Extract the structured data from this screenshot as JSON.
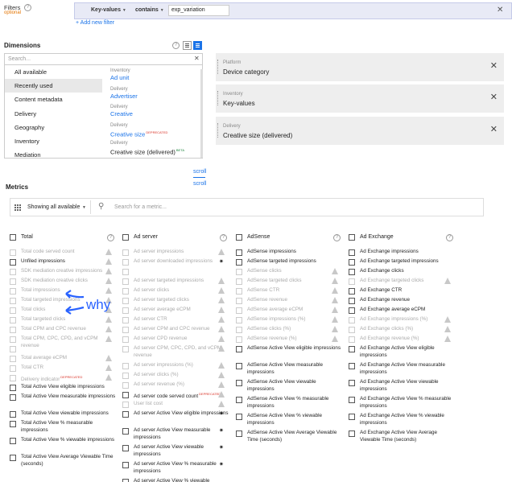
{
  "filters": {
    "label": "Filters",
    "optional": "optional",
    "key": "Key-values",
    "operator": "contains",
    "value": "exp_variation",
    "add_filter": "+ Add new filter"
  },
  "dimensions": {
    "title": "Dimensions",
    "search_placeholder": "Search...",
    "categories": [
      "All available",
      "Recently used",
      "Content metadata",
      "Delivery",
      "Geography",
      "Inventory",
      "Mediation"
    ],
    "selected_category": "Recently used",
    "items": [
      {
        "category": "Inventory",
        "name": "Ad unit"
      },
      {
        "category": "Delivery",
        "name": "Advertiser"
      },
      {
        "category": "Delivery",
        "name": "Creative"
      },
      {
        "category": "Delivery",
        "name": "Creative size",
        "tag": "DEPRECATED"
      },
      {
        "category": "Delivery",
        "name": "Creative size (delivered)",
        "tag": "BETA"
      }
    ],
    "scroll_label": "scroll",
    "selected": [
      {
        "category": "Platform",
        "name": "Device category"
      },
      {
        "category": "Inventory",
        "name": "Key-values"
      },
      {
        "category": "Delivery",
        "name": "Creative size (delivered)"
      }
    ]
  },
  "metrics": {
    "title": "Metrics",
    "show_label": "Showing all available",
    "search_placeholder": "Search for a metric...",
    "columns": [
      {
        "title": "Total",
        "rows": [
          {
            "label": "Total code served count",
            "disabled": true,
            "warn": true
          },
          {
            "label": "Unfiled impressions",
            "disabled": false,
            "warn": true
          },
          {
            "label": "SDK mediation creative impressions",
            "disabled": true,
            "warn": true
          },
          {
            "label": "SDK mediation creative clicks",
            "disabled": true,
            "warn": true
          },
          {
            "label": "Total impressions",
            "disabled": true,
            "warn": true
          },
          {
            "label": "Total targeted impressions",
            "disabled": true,
            "warn": true
          },
          {
            "label": "Total clicks",
            "disabled": true,
            "warn": true
          },
          {
            "label": "Total targeted clicks",
            "disabled": true,
            "warn": true
          },
          {
            "label": "Total CPM and CPC revenue",
            "disabled": true,
            "warn": true
          },
          {
            "label": "Total CPM, CPC, CPD, and vCPM revenue",
            "disabled": true,
            "warn": true
          },
          {
            "label": "",
            "disabled": true,
            "warn": false
          },
          {
            "label": "Total average eCPM",
            "disabled": true,
            "warn": true
          },
          {
            "label": "Total CTR",
            "disabled": true,
            "warn": true
          },
          {
            "label": "Delivery indicator",
            "tag": "DEPRECATED",
            "disabled": true,
            "warn": true
          },
          {
            "label": "Total Active View eligible impressions",
            "disabled": false
          },
          {
            "label": "Total Active View measurable impressions",
            "disabled": false,
            "lines": 2
          },
          {
            "label": "Total Active View viewable impressions",
            "disabled": false
          },
          {
            "label": "Total Active View % measurable impressions",
            "disabled": false,
            "lines": 2
          },
          {
            "label": "Total Active View % viewable impressions",
            "disabled": false,
            "lines": 2
          },
          {
            "label": "Total Active View Average Viewable Time (seconds)",
            "disabled": false,
            "lines": 2
          }
        ]
      },
      {
        "title": "Ad server",
        "rows": [
          {
            "label": "Ad server impressions",
            "disabled": true,
            "warn": true
          },
          {
            "label": "Ad server downloaded impressions",
            "disabled": true,
            "bug": true
          },
          {
            "label": "",
            "disabled": true
          },
          {
            "label": "Ad server targeted impressions",
            "disabled": true,
            "warn": true
          },
          {
            "label": "Ad server clicks",
            "disabled": true,
            "warn": true
          },
          {
            "label": "Ad server targeted clicks",
            "disabled": true,
            "warn": true
          },
          {
            "label": "Ad server average eCPM",
            "disabled": true,
            "warn": true
          },
          {
            "label": "Ad server CTR",
            "disabled": true,
            "warn": true
          },
          {
            "label": "Ad server CPM and CPC revenue",
            "disabled": true,
            "warn": true
          },
          {
            "label": "Ad server CPD revenue",
            "disabled": true,
            "warn": true
          },
          {
            "label": "Ad server CPM, CPC, CPD, and vCPM revenue",
            "disabled": true,
            "warn": true,
            "lines": 2
          },
          {
            "label": "Ad server impressions (%)",
            "disabled": true,
            "warn": true
          },
          {
            "label": "Ad server clicks (%)",
            "disabled": true,
            "warn": true
          },
          {
            "label": "Ad server revenue (%)",
            "disabled": true,
            "warn": true
          },
          {
            "label": "Ad server code served count",
            "tag": "DEPRECATED",
            "disabled": false,
            "warn": true
          },
          {
            "label": "User list cost",
            "disabled": true,
            "warn": true
          },
          {
            "label": "Ad server Active View eligible impressions",
            "disabled": false,
            "bug": true,
            "lines": 2
          },
          {
            "label": "Ad server Active View measurable impressions",
            "disabled": false,
            "bug": true,
            "lines": 2
          },
          {
            "label": "Ad server Active View viewable impressions",
            "disabled": false,
            "bug": true,
            "lines": 2
          },
          {
            "label": "Ad server Active View % measurable impressions",
            "disabled": false,
            "bug": true,
            "lines": 2
          },
          {
            "label": "Ad server Active View % viewable",
            "disabled": false
          }
        ]
      },
      {
        "title": "AdSense",
        "rows": [
          {
            "label": "AdSense impressions",
            "disabled": false
          },
          {
            "label": "AdSense targeted impressions",
            "disabled": false
          },
          {
            "label": "AdSense clicks",
            "disabled": true,
            "warn": true
          },
          {
            "label": "AdSense targeted clicks",
            "disabled": true,
            "warn": true
          },
          {
            "label": "AdSense CTR",
            "disabled": true,
            "warn": true
          },
          {
            "label": "AdSense revenue",
            "disabled": true,
            "warn": true
          },
          {
            "label": "AdSense average eCPM",
            "disabled": true,
            "warn": true
          },
          {
            "label": "AdSense impressions (%)",
            "disabled": true,
            "warn": true
          },
          {
            "label": "AdSense clicks (%)",
            "disabled": true,
            "warn": true
          },
          {
            "label": "AdSense revenue (%)",
            "disabled": true,
            "warn": true
          },
          {
            "label": "AdSense Active View eligible impressions",
            "disabled": false,
            "lines": 2
          },
          {
            "label": "AdSense Active View measurable impressions",
            "disabled": false,
            "lines": 2
          },
          {
            "label": "AdSense Active View viewable impressions",
            "disabled": false,
            "lines": 2
          },
          {
            "label": "AdSense Active View % measurable impressions",
            "disabled": false,
            "lines": 2
          },
          {
            "label": "AdSense Active View % viewable impressions",
            "disabled": false,
            "lines": 2
          },
          {
            "label": "AdSense Active View Average Viewable Time (seconds)",
            "disabled": false,
            "lines": 2
          }
        ]
      },
      {
        "title": "Ad Exchange",
        "rows": [
          {
            "label": "Ad Exchange impressions",
            "disabled": false
          },
          {
            "label": "Ad Exchange targeted impressions",
            "disabled": false
          },
          {
            "label": "Ad Exchange clicks",
            "disabled": false
          },
          {
            "label": "Ad Exchange targeted clicks",
            "disabled": true,
            "warn": true
          },
          {
            "label": "Ad Exchange CTR",
            "disabled": false
          },
          {
            "label": "Ad Exchange revenue",
            "disabled": false
          },
          {
            "label": "Ad Exchange average eCPM",
            "disabled": false
          },
          {
            "label": "Ad Exchange impressions (%)",
            "disabled": true,
            "warn": true
          },
          {
            "label": "Ad Exchange clicks (%)",
            "disabled": true,
            "warn": true
          },
          {
            "label": "Ad Exchange revenue (%)",
            "disabled": true,
            "warn": true
          },
          {
            "label": "Ad Exchange Active View eligible impressions",
            "disabled": false,
            "lines": 2
          },
          {
            "label": "Ad Exchange Active View measurable impressions",
            "disabled": false,
            "lines": 2
          },
          {
            "label": "Ad Exchange Active View viewable impressions",
            "disabled": false,
            "lines": 2
          },
          {
            "label": "Ad Exchange Active View % measurable impressions",
            "disabled": false,
            "lines": 2
          },
          {
            "label": "Ad Exchange Active View % viewable impressions",
            "disabled": false,
            "lines": 2
          },
          {
            "label": "Ad Exchange Active View Average Viewable Time (seconds)",
            "disabled": false,
            "lines": 2
          }
        ]
      }
    ]
  },
  "annotation": {
    "text": "why",
    "color": "#2962ff"
  },
  "colors": {
    "accent": "#1a73e8",
    "deprecated": "#d93025",
    "beta": "#188038"
  }
}
